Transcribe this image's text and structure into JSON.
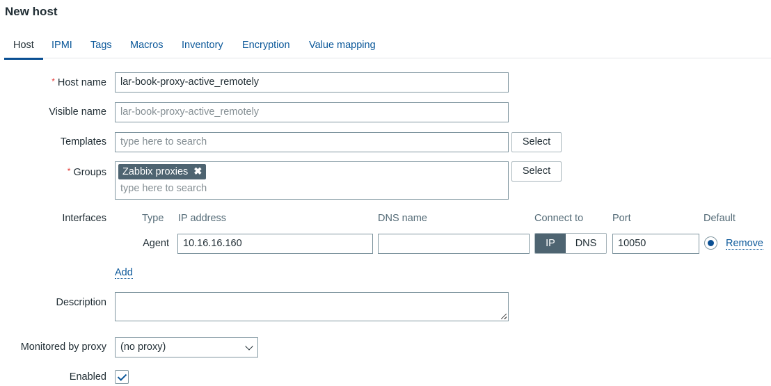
{
  "page": {
    "title": "New host"
  },
  "tabs": [
    {
      "label": "Host",
      "active": true
    },
    {
      "label": "IPMI"
    },
    {
      "label": "Tags"
    },
    {
      "label": "Macros"
    },
    {
      "label": "Inventory"
    },
    {
      "label": "Encryption"
    },
    {
      "label": "Value mapping"
    }
  ],
  "form": {
    "host_name": {
      "label": "Host name",
      "required": "*",
      "value": "lar-book-proxy-active_remotely"
    },
    "visible_name": {
      "label": "Visible name",
      "placeholder": "lar-book-proxy-active_remotely"
    },
    "templates": {
      "label": "Templates",
      "placeholder": "type here to search",
      "select_label": "Select"
    },
    "groups": {
      "label": "Groups",
      "required": "*",
      "selected": [
        {
          "label": "Zabbix proxies",
          "remove_icon": "✖"
        }
      ],
      "placeholder": "type here to search",
      "select_label": "Select"
    },
    "interfaces": {
      "label": "Interfaces",
      "headers": {
        "type": "Type",
        "ip": "IP address",
        "dns": "DNS name",
        "connect": "Connect to",
        "port": "Port",
        "default": "Default"
      },
      "rows": [
        {
          "type": "Agent",
          "ip": "10.16.16.160",
          "dns": "",
          "connect_options": [
            "IP",
            "DNS"
          ],
          "connect_selected": "IP",
          "port": "10050",
          "default": true,
          "remove_label": "Remove"
        }
      ],
      "add_label": "Add"
    },
    "description": {
      "label": "Description",
      "value": ""
    },
    "proxy": {
      "label": "Monitored by proxy",
      "value": "(no proxy)"
    },
    "enabled": {
      "label": "Enabled",
      "checked": true
    }
  },
  "colors": {
    "accent": "#0a4f93",
    "link": "#0a5799",
    "chip": "#4e6471",
    "required": "#e33734"
  }
}
